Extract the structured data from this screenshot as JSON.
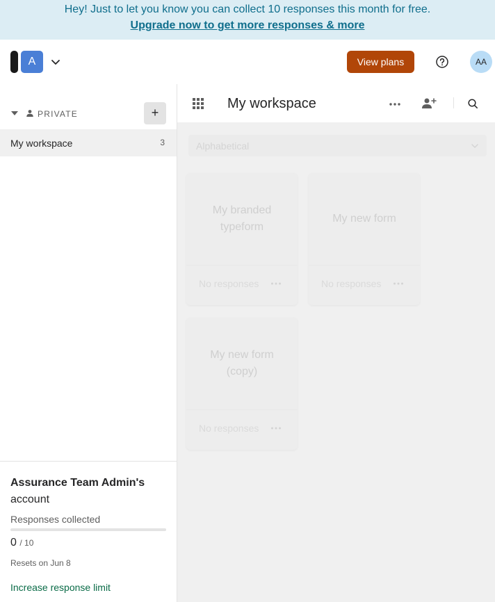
{
  "banner": {
    "message": "Hey! Just to let you know you can collect 10 responses this month for free.",
    "link": "Upgrade now to get more responses & more"
  },
  "topbar": {
    "org_avatar_letter": "A",
    "view_plans_label": "View plans",
    "user_initials": "AA"
  },
  "sidebar": {
    "section_label": "PRIVATE",
    "add_label": "+",
    "workspaces": [
      {
        "label": "My workspace",
        "count": "3"
      }
    ]
  },
  "account": {
    "owner": "Assurance Team Admin's",
    "suffix": "account",
    "responses_label": "Responses collected",
    "collected": "0",
    "limit": "/ 10",
    "progress_fraction": 0,
    "resets": "Resets on Jun 8",
    "increase_link": "Increase response limit"
  },
  "main": {
    "workspace_title": "My workspace",
    "sort_value": "Alphabetical",
    "forms": [
      {
        "title": "My branded typeform",
        "responses": "No responses"
      },
      {
        "title": "My new form",
        "responses": "No responses"
      },
      {
        "title": "My new form (copy)",
        "responses": "No responses"
      }
    ]
  },
  "icons": {
    "caret": "caret-down-icon",
    "person": "person-icon",
    "chevron": "chevron-down-icon",
    "help": "help-circle-icon",
    "grid": "apps-grid-icon",
    "more": "more-horizontal-icon",
    "invite": "invite-user-icon",
    "search": "search-icon"
  },
  "colors": {
    "banner_bg": "#dcedf4",
    "banner_text": "#0f6e8c",
    "primary_button": "#b14608",
    "link_green": "#0a6b47",
    "avatar_bg": "#b9dcf6"
  }
}
